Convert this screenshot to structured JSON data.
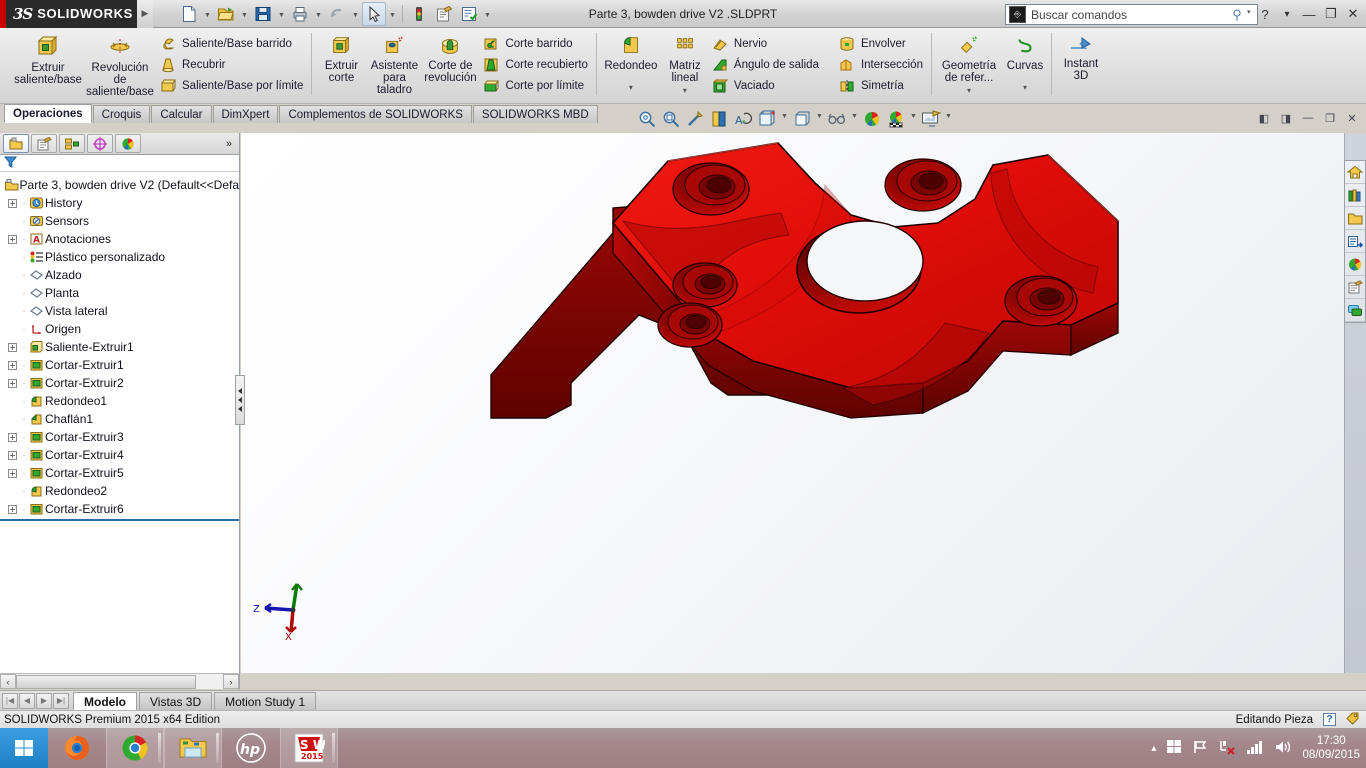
{
  "titlebar": {
    "brand_ds": "3S",
    "brand_name": "SOLIDWORKS",
    "document_title": "Parte 3, bowden drive V2 .SLDPRT",
    "expand_arrow": "▶",
    "quick_access": [
      {
        "name": "new-document",
        "icon": "new-doc-icon",
        "caret": true
      },
      {
        "name": "open-document",
        "icon": "open-folder-icon",
        "caret": true
      },
      {
        "name": "save-document",
        "icon": "save-disk-icon",
        "caret": true
      },
      {
        "name": "print-document",
        "icon": "printer-icon",
        "caret": true
      },
      {
        "name": "undo",
        "icon": "undo-arrow-icon",
        "caret": true
      },
      {
        "name": "select",
        "icon": "cursor-arrow-icon",
        "caret": true,
        "selected": true
      },
      {
        "name": "rebuild",
        "icon": "traffic-light-icon",
        "caret": false
      },
      {
        "name": "file-properties",
        "icon": "properties-icon",
        "caret": false
      },
      {
        "name": "options",
        "icon": "options-checklist-icon",
        "caret": true
      }
    ],
    "window_controls": [
      {
        "name": "help-button",
        "glyph": "?"
      },
      {
        "name": "help-caret",
        "glyph": "▾"
      },
      {
        "name": "minimize-button",
        "glyph": "—"
      },
      {
        "name": "restore-button",
        "glyph": "❐"
      },
      {
        "name": "close-button",
        "glyph": "✕"
      }
    ]
  },
  "search": {
    "placeholder": "Buscar comandos",
    "value": "",
    "icon": "command-search-icon",
    "magnifier": "search-icon",
    "caret": "▾"
  },
  "ribbon": {
    "groups": [
      {
        "name": "extrude-boss-group",
        "big": [
          {
            "label": "Extruir\nsaliente/base",
            "icon": "extrude-boss-icon",
            "name": "extrude-boss-base-button"
          },
          {
            "label": "Revolución\nde\nsaliente/base",
            "icon": "revolve-boss-icon",
            "name": "revolve-boss-base-button"
          }
        ],
        "small": [
          {
            "label": "Saliente/Base barrido",
            "icon": "swept-boss-icon",
            "name": "swept-boss-button"
          },
          {
            "label": "Recubrir",
            "icon": "lofted-boss-icon",
            "name": "lofted-boss-button"
          },
          {
            "label": "Saliente/Base por límite",
            "icon": "boundary-boss-icon",
            "name": "boundary-boss-button"
          }
        ]
      },
      {
        "name": "cut-group",
        "big": [
          {
            "label": "Extruir\ncorte",
            "icon": "extruded-cut-icon",
            "name": "extruded-cut-button"
          },
          {
            "label": "Asistente\npara\ntaladro",
            "icon": "hole-wizard-icon",
            "name": "hole-wizard-button"
          },
          {
            "label": "Corte de\nrevolución",
            "icon": "revolved-cut-icon",
            "name": "revolved-cut-button"
          }
        ],
        "small": [
          {
            "label": "Corte barrido",
            "icon": "swept-cut-icon",
            "name": "swept-cut-button"
          },
          {
            "label": "Corte recubierto",
            "icon": "lofted-cut-icon",
            "name": "lofted-cut-button"
          },
          {
            "label": "Corte por límite",
            "icon": "boundary-cut-icon",
            "name": "boundary-cut-button"
          }
        ]
      },
      {
        "name": "features-group",
        "big": [
          {
            "label": "Redondeo",
            "icon": "fillet-icon",
            "name": "fillet-button",
            "caret": "▾"
          },
          {
            "label": "Matriz\nlineal",
            "icon": "linear-pattern-icon",
            "name": "linear-pattern-button",
            "caret": "▾"
          }
        ],
        "small": [
          {
            "label": "Nervio",
            "icon": "rib-icon",
            "name": "rib-button"
          },
          {
            "label": "Ángulo de salida",
            "icon": "draft-icon",
            "name": "draft-button"
          },
          {
            "label": "Vaciado",
            "icon": "shell-icon",
            "name": "shell-button"
          }
        ],
        "small2": [
          {
            "label": "Envolver",
            "icon": "wrap-icon",
            "name": "wrap-button"
          },
          {
            "label": "Intersección",
            "icon": "intersect-icon",
            "name": "intersect-button"
          },
          {
            "label": "Simetría",
            "icon": "mirror-icon",
            "name": "mirror-button"
          }
        ]
      },
      {
        "name": "reference-group",
        "big": [
          {
            "label": "Geometría\nde refer...",
            "icon": "reference-geometry-icon",
            "name": "reference-geometry-button",
            "caret": "▾"
          },
          {
            "label": "Curvas",
            "icon": "curves-icon",
            "name": "curves-button",
            "caret": "▾"
          }
        ],
        "small": []
      },
      {
        "name": "instant3d-group",
        "big": [
          {
            "label": "Instant\n3D",
            "icon": "instant3d-icon",
            "name": "instant-3d-button"
          }
        ],
        "small": []
      }
    ]
  },
  "command_tabs": [
    {
      "label": "Operaciones",
      "active": true,
      "name": "tab-operaciones"
    },
    {
      "label": "Croquis",
      "active": false,
      "name": "tab-croquis"
    },
    {
      "label": "Calcular",
      "active": false,
      "name": "tab-calcular"
    },
    {
      "label": "DimXpert",
      "active": false,
      "name": "tab-dimxpert"
    },
    {
      "label": "Complementos de SOLIDWORKS",
      "active": false,
      "name": "tab-complementos"
    },
    {
      "label": "SOLIDWORKS MBD",
      "active": false,
      "name": "tab-mbd"
    }
  ],
  "view_toolbar": [
    {
      "name": "zoom-to-fit-icon",
      "caret": false
    },
    {
      "name": "zoom-to-area-icon",
      "caret": false
    },
    {
      "name": "previous-view-icon",
      "caret": false
    },
    {
      "name": "section-view-icon",
      "caret": false
    },
    {
      "name": "view-orientation-icon",
      "caret": false
    },
    {
      "name": "display-style-icon",
      "caret": true
    },
    {
      "name": "hide-show-items-icon",
      "caret": true
    },
    {
      "name": "edit-appearance-icon",
      "caret": true
    },
    {
      "name": "apply-scene-icon",
      "caret": false
    },
    {
      "name": "view-settings-icon",
      "caret": true
    },
    {
      "name": "render-tools-icon",
      "caret": true
    }
  ],
  "document_window_controls": [
    {
      "name": "tile-left-button",
      "glyph": "◧"
    },
    {
      "name": "tile-right-button",
      "glyph": "◨"
    },
    {
      "name": "doc-minimize-button",
      "glyph": "—"
    },
    {
      "name": "doc-restore-button",
      "glyph": "❐"
    },
    {
      "name": "doc-close-button",
      "glyph": "✕"
    }
  ],
  "feature_manager": {
    "tabs": [
      {
        "name": "feature-manager-tab",
        "icon": "feature-tree-icon",
        "active": true
      },
      {
        "name": "property-manager-tab",
        "icon": "property-manager-icon",
        "active": false
      },
      {
        "name": "configuration-manager-tab",
        "icon": "configuration-manager-icon",
        "active": false
      },
      {
        "name": "dimxpert-manager-tab",
        "icon": "dimxpert-manager-icon",
        "active": false
      },
      {
        "name": "display-manager-tab",
        "icon": "display-manager-icon",
        "active": false
      }
    ],
    "more_glyph": "»",
    "filter_icon": "filter-funnel-icon",
    "tree": [
      {
        "label": "Parte 3, bowden drive V2  (Default<<Defa",
        "icon": "part-icon",
        "expand": "none",
        "level": 0
      },
      {
        "label": "History",
        "icon": "history-icon",
        "expand": "+",
        "level": 1
      },
      {
        "label": "Sensors",
        "icon": "sensors-icon",
        "expand": "none",
        "level": 1
      },
      {
        "label": "Anotaciones",
        "icon": "annotations-icon",
        "expand": "+",
        "level": 1
      },
      {
        "label": "Plástico personalizado",
        "icon": "material-icon",
        "expand": "none",
        "level": 1
      },
      {
        "label": "Alzado",
        "icon": "plane-icon",
        "expand": "none",
        "level": 1
      },
      {
        "label": "Planta",
        "icon": "plane-icon",
        "expand": "none",
        "level": 1
      },
      {
        "label": "Vista lateral",
        "icon": "plane-icon",
        "expand": "none",
        "level": 1
      },
      {
        "label": "Origen",
        "icon": "origin-icon",
        "expand": "none",
        "level": 1
      },
      {
        "label": "Saliente-Extruir1",
        "icon": "extrude-feature-icon",
        "expand": "+",
        "level": 1
      },
      {
        "label": "Cortar-Extruir1",
        "icon": "cut-feature-icon",
        "expand": "+",
        "level": 1
      },
      {
        "label": "Cortar-Extruir2",
        "icon": "cut-feature-icon",
        "expand": "+",
        "level": 1
      },
      {
        "label": "Redondeo1",
        "icon": "fillet-feature-icon",
        "expand": "none",
        "level": 1
      },
      {
        "label": "Chaflán1",
        "icon": "chamfer-feature-icon",
        "expand": "none",
        "level": 1
      },
      {
        "label": "Cortar-Extruir3",
        "icon": "cut-feature-icon",
        "expand": "+",
        "level": 1
      },
      {
        "label": "Cortar-Extruir4",
        "icon": "cut-feature-icon",
        "expand": "+",
        "level": 1
      },
      {
        "label": "Cortar-Extruir5",
        "icon": "cut-feature-icon",
        "expand": "+",
        "level": 1
      },
      {
        "label": "Redondeo2",
        "icon": "fillet-feature-icon",
        "expand": "none",
        "level": 1
      },
      {
        "label": "Cortar-Extruir6",
        "icon": "cut-feature-icon",
        "expand": "+",
        "level": 1
      }
    ],
    "hscroll": {
      "left_arrow": "‹",
      "right_arrow": "›"
    }
  },
  "task_pane": [
    {
      "name": "solidworks-resources-tab",
      "icon": "home-icon"
    },
    {
      "name": "design-library-tab",
      "icon": "library-books-icon"
    },
    {
      "name": "file-explorer-tab",
      "icon": "folder-icon"
    },
    {
      "name": "view-palette-tab",
      "icon": "view-palette-icon"
    },
    {
      "name": "appearances-scenes-tab",
      "icon": "appearances-sphere-icon"
    },
    {
      "name": "custom-properties-tab",
      "icon": "custom-properties-icon"
    },
    {
      "name": "solidworks-forum-tab",
      "icon": "forum-bubble-icon"
    }
  ],
  "model": {
    "name": "bowden-drive-plate",
    "color": "#e01010",
    "triad": {
      "x_label": "",
      "y_label": "",
      "z_label": "Z"
    }
  },
  "bottom_tabs": {
    "nav": [
      "|◀",
      "◀",
      "▶",
      "▶|"
    ],
    "tabs": [
      {
        "label": "Modelo",
        "active": true,
        "name": "doc-tab-modelo"
      },
      {
        "label": "Vistas 3D",
        "active": false,
        "name": "doc-tab-vistas-3d"
      },
      {
        "label": "Motion Study 1",
        "active": false,
        "name": "doc-tab-motion-study"
      }
    ]
  },
  "statusbar": {
    "edition": "SOLIDWORKS Premium 2015 x64 Edition",
    "mode": "Editando Pieza",
    "help_glyph": "?",
    "tag_icon": "tag-icon"
  },
  "taskbar": {
    "start": {
      "name": "start-button",
      "icon": "windows-logo-icon"
    },
    "items": [
      {
        "name": "taskbar-firefox",
        "icon": "firefox-icon",
        "open": false
      },
      {
        "name": "taskbar-chrome",
        "icon": "chrome-icon",
        "open": true
      },
      {
        "name": "taskbar-file-explorer",
        "icon": "file-explorer-icon",
        "open": true
      },
      {
        "name": "taskbar-hp",
        "icon": "hp-icon",
        "open": false
      },
      {
        "name": "taskbar-solidworks",
        "icon": "solidworks-2015-icon",
        "open": true,
        "badge": "2015"
      }
    ],
    "tray": {
      "show_hidden": "▴",
      "icons": [
        {
          "name": "tray-windows-icon"
        },
        {
          "name": "tray-flag-icon"
        },
        {
          "name": "tray-network-error-icon"
        },
        {
          "name": "tray-signal-icon"
        },
        {
          "name": "tray-volume-icon"
        }
      ],
      "time": "17:30",
      "date": "08/09/2015"
    }
  }
}
